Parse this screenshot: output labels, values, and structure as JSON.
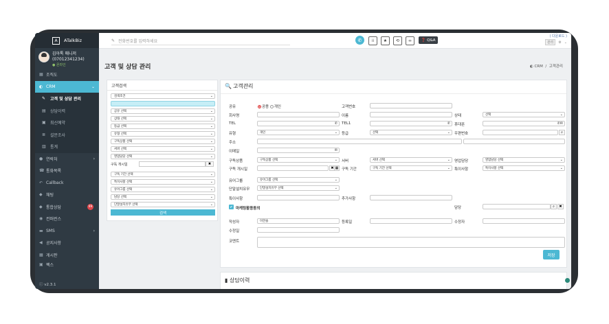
{
  "app": {
    "brand": "ATalkBiz",
    "logo_letter": "A",
    "version": "v2.3.1"
  },
  "profile": {
    "name_line1": "김아톡 매니저",
    "name_line2": "(07012341234)",
    "status": "온라인"
  },
  "sidebar": {
    "items": [
      {
        "label": "조직도",
        "icon": "org-icon"
      },
      {
        "label": "CRM",
        "icon": "headset-icon",
        "active": true
      },
      {
        "label": "연락처",
        "icon": "person-icon"
      },
      {
        "label": "통화목록",
        "icon": "phone-list-icon"
      },
      {
        "label": "Callback",
        "icon": "callback-icon"
      },
      {
        "label": "채팅",
        "icon": "chat-icon"
      },
      {
        "label": "통합상담",
        "icon": "comments-icon",
        "badge": "99"
      },
      {
        "label": "컨퍼런스",
        "icon": "conference-icon"
      },
      {
        "label": "SMS",
        "icon": "sms-icon"
      },
      {
        "label": "공지사항",
        "icon": "megaphone-icon"
      },
      {
        "label": "게시판",
        "icon": "board-icon"
      },
      {
        "label": "팩스",
        "icon": "fax-icon"
      }
    ],
    "crm_sub": [
      {
        "label": "고객 및 상담 관리",
        "current": true
      },
      {
        "label": "상담이력"
      },
      {
        "label": "최신예약"
      },
      {
        "label": "설문조사"
      },
      {
        "label": "통계"
      }
    ]
  },
  "topbar": {
    "phone_placeholder": "전화번호를 입력하세요",
    "qa_label": "Q&A",
    "top_link": "( 다운로드 )",
    "user_badge": "관리"
  },
  "page": {
    "title": "고객 및 상담 관리",
    "crumb_root": "CRM",
    "crumb_current": "고객관리"
  },
  "search": {
    "title": "고객검색",
    "condition": "검색조건",
    "selects": [
      "공유 선택",
      "상태 선택",
      "등급 선택",
      "유형 선택",
      "구독상품 선택",
      "서버 선택",
      "영업담당 선택"
    ],
    "sub_start_label": "구독 개시일",
    "selects2": [
      "구독 기간 선택",
      "특이사항 선택",
      "유어그룹 선택",
      "담당 선택",
      "단말설치유무 선택"
    ],
    "button": "검색"
  },
  "form": {
    "title": "고객관리",
    "labels": {
      "share": "공유",
      "customer_no": "고객번호",
      "company": "회사명",
      "name": "이름",
      "status": "상태",
      "tel": "TEL",
      "tel1": "TEL1",
      "mobile": "휴대폰",
      "type": "유형",
      "grade": "등급",
      "zip": "우편번호",
      "address": "주소",
      "email": "이메일",
      "product": "구독상품",
      "server": "서버",
      "sales": "영업담당",
      "sub_start": "구독 개시일",
      "sub_period": "구독 기간",
      "special": "특이사항",
      "group": "유어그룹",
      "device": "단말설치유무",
      "note": "특이사항",
      "extra": "추가사항",
      "consent": "마케팅활용동의",
      "owner": "담당",
      "writer": "작성자",
      "reg_date": "등록일",
      "modifier": "수정자",
      "mod_date": "수정일",
      "comment": "코멘트"
    },
    "share_options": {
      "shared": "공용",
      "private": "개인"
    },
    "values": {
      "status": "선택",
      "type": "개인",
      "grade": "선택",
      "product": "구독상품 선택",
      "server": "서버 선택",
      "sales": "영업담당 선택",
      "sub_period": "구독 기간 선택",
      "special": "특이사항 선택",
      "group": "유어그룹 선택",
      "device": "단말설치유무 선택",
      "writer": "이한솔"
    },
    "save": "저장"
  },
  "history": {
    "title": "상담이력"
  }
}
